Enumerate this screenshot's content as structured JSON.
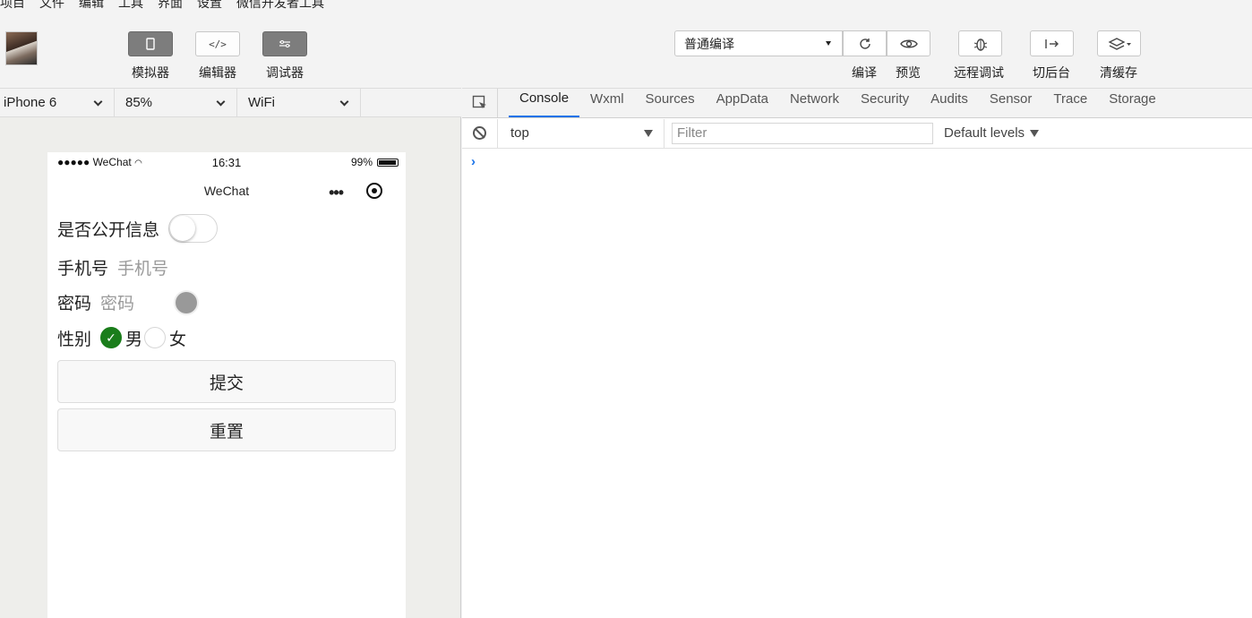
{
  "menubar": [
    "项目",
    "文件",
    "编辑",
    "工具",
    "界面",
    "设置",
    "微信开发者工具"
  ],
  "toolbar": {
    "simulator": "模拟器",
    "editor": "编辑器",
    "debugger": "调试器",
    "compile_mode": "普通编译",
    "compile": "编译",
    "preview": "预览",
    "remote_debug": "远程调试",
    "background": "切后台",
    "clear_cache": "清缓存"
  },
  "devicebar": {
    "device": "iPhone 6",
    "zoom": "85%",
    "network": "WiFi"
  },
  "phone": {
    "status": {
      "signal": "●●●●● WeChat",
      "time": "16:31",
      "battery": "99%"
    },
    "nav_title": "WeChat",
    "form": {
      "public_label": "是否公开信息",
      "public_on": false,
      "phone_label": "手机号",
      "phone_placeholder": "手机号",
      "password_label": "密码",
      "password_placeholder": "密码",
      "gender_label": "性别",
      "gender_male": "男",
      "gender_female": "女",
      "gender_selected": "男",
      "submit": "提交",
      "reset": "重置"
    }
  },
  "devtools": {
    "tabs": [
      "Console",
      "Wxml",
      "Sources",
      "AppData",
      "Network",
      "Security",
      "Audits",
      "Sensor",
      "Trace",
      "Storage"
    ],
    "active_tab": "Console",
    "context": "top",
    "filter_placeholder": "Filter",
    "levels": "Default levels",
    "prompt": "›"
  },
  "colors": {
    "accent": "#1a73e8",
    "radio_on": "#1a7d1b"
  }
}
